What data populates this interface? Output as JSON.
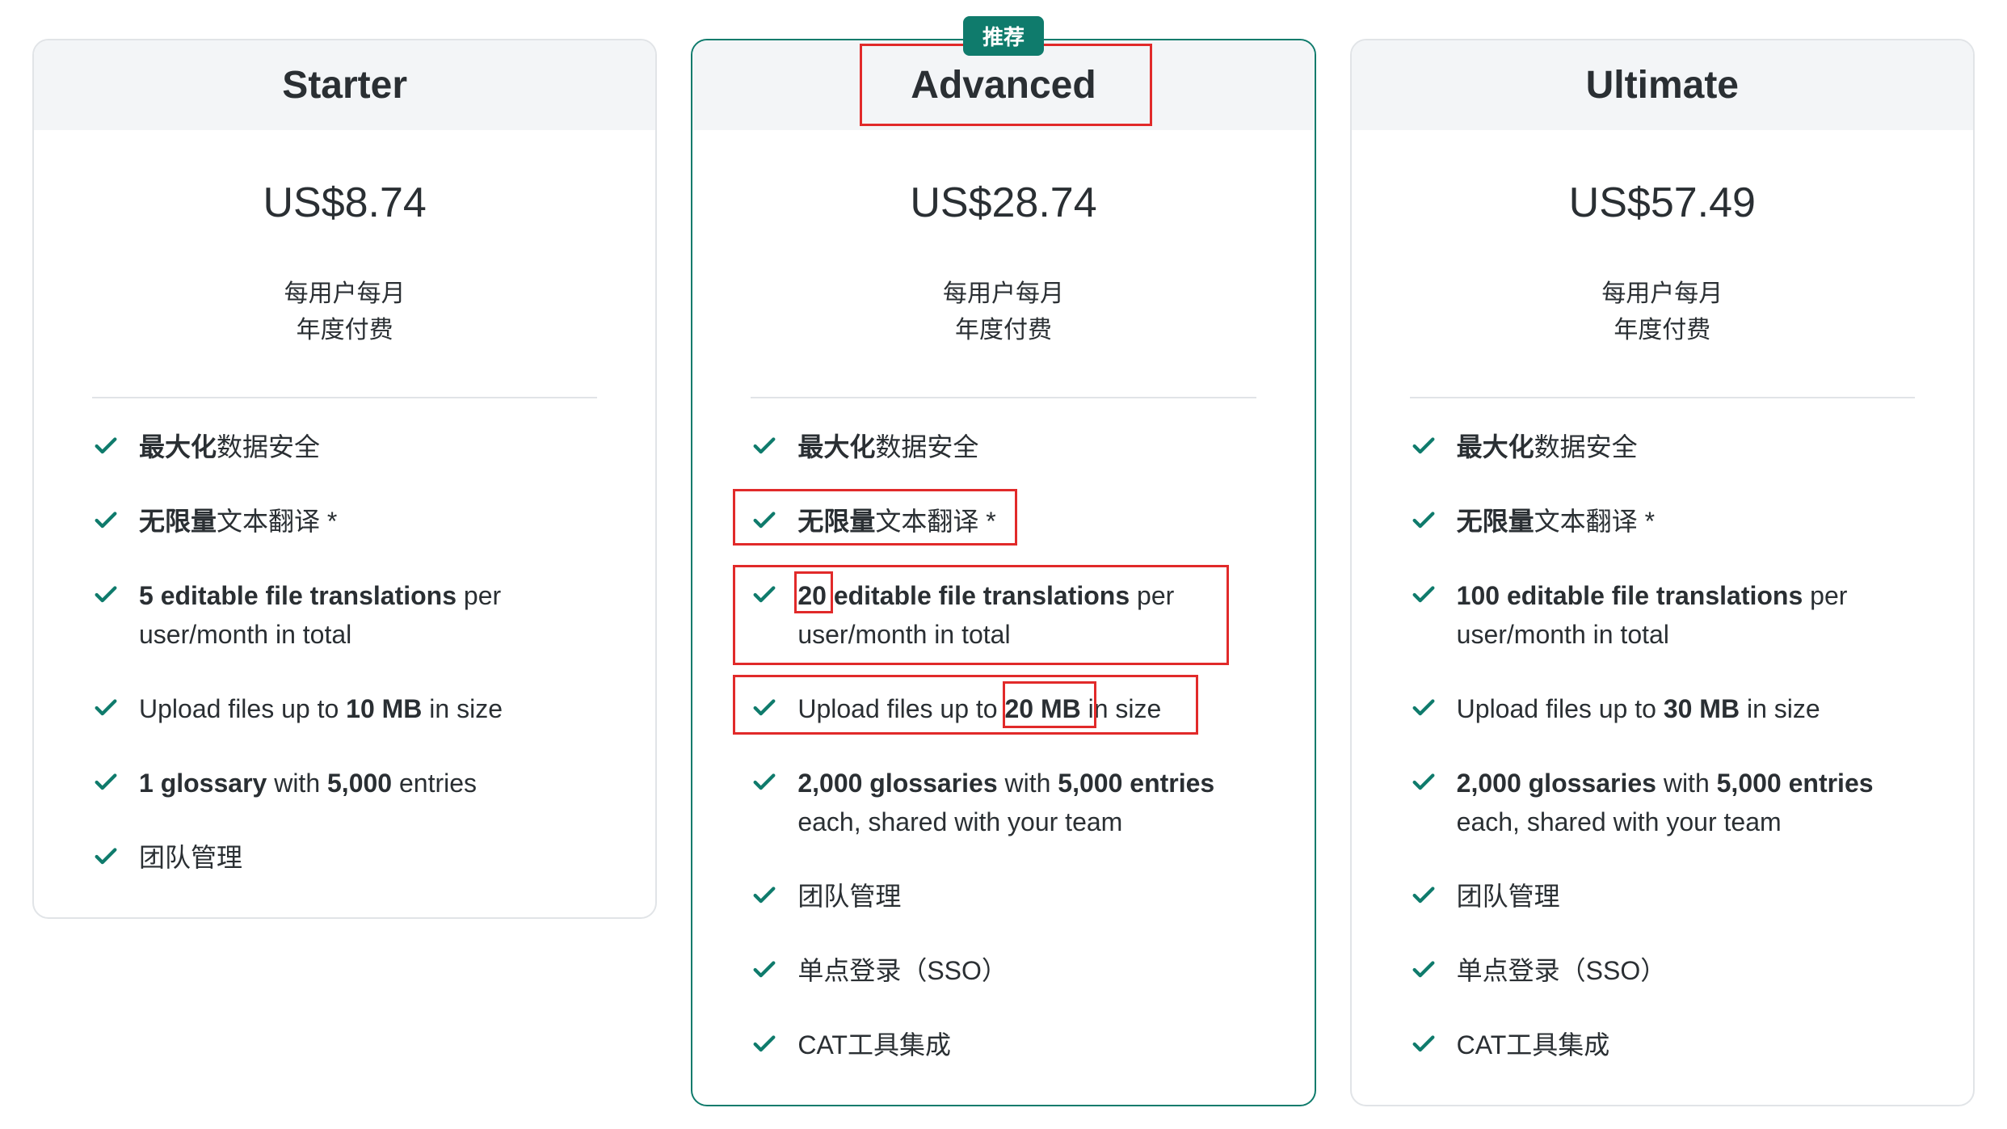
{
  "badge": "推荐",
  "plans": [
    {
      "name": "Starter",
      "price": "US$8.74",
      "billing_line1": "每用户每月",
      "billing_line2": "年度付费",
      "features": [
        {
          "b1": "最大化",
          "t1": "数据安全"
        },
        {
          "b1": "无限量",
          "t1": "文本翻译 *"
        },
        {
          "b1": "5 editable file translations",
          "t1": " per user/month in total"
        },
        {
          "t0": "Upload files up to ",
          "b1": "10 MB",
          "t1": " in size"
        },
        {
          "b1": "1 glossary",
          "t1": " with ",
          "b2": "5,000",
          "t2": " entries"
        },
        {
          "t0": "团队管理"
        }
      ]
    },
    {
      "name": "Advanced",
      "price": "US$28.74",
      "billing_line1": "每用户每月",
      "billing_line2": "年度付费",
      "features": [
        {
          "b1": "最大化",
          "t1": "数据安全"
        },
        {
          "b1": "无限量",
          "t1": "文本翻译 *"
        },
        {
          "b1": "20 editable file translations",
          "t1": " per user/month in total"
        },
        {
          "t0": "Upload files up to ",
          "b1": "20 MB",
          "t1": " in size"
        },
        {
          "b1": "2,000 glossaries",
          "t1": " with ",
          "b2": "5,000 entries",
          "t2": " each, shared with your team"
        },
        {
          "t0": "团队管理"
        },
        {
          "t0": "单点登录（SSO）"
        },
        {
          "t0": "CAT工具集成"
        }
      ]
    },
    {
      "name": "Ultimate",
      "price": "US$57.49",
      "billing_line1": "每用户每月",
      "billing_line2": "年度付费",
      "features": [
        {
          "b1": "最大化",
          "t1": "数据安全"
        },
        {
          "b1": "无限量",
          "t1": "文本翻译 *"
        },
        {
          "b1": "100 editable file translations",
          "t1": " per user/month in total"
        },
        {
          "t0": "Upload files up to ",
          "b1": "30 MB",
          "t1": " in size"
        },
        {
          "b1": "2,000 glossaries",
          "t1": " with ",
          "b2": "5,000 entries",
          "t2": " each, shared with your team"
        },
        {
          "t0": "团队管理"
        },
        {
          "t0": "单点登录（SSO）"
        },
        {
          "t0": "CAT工具集成"
        }
      ]
    }
  ]
}
